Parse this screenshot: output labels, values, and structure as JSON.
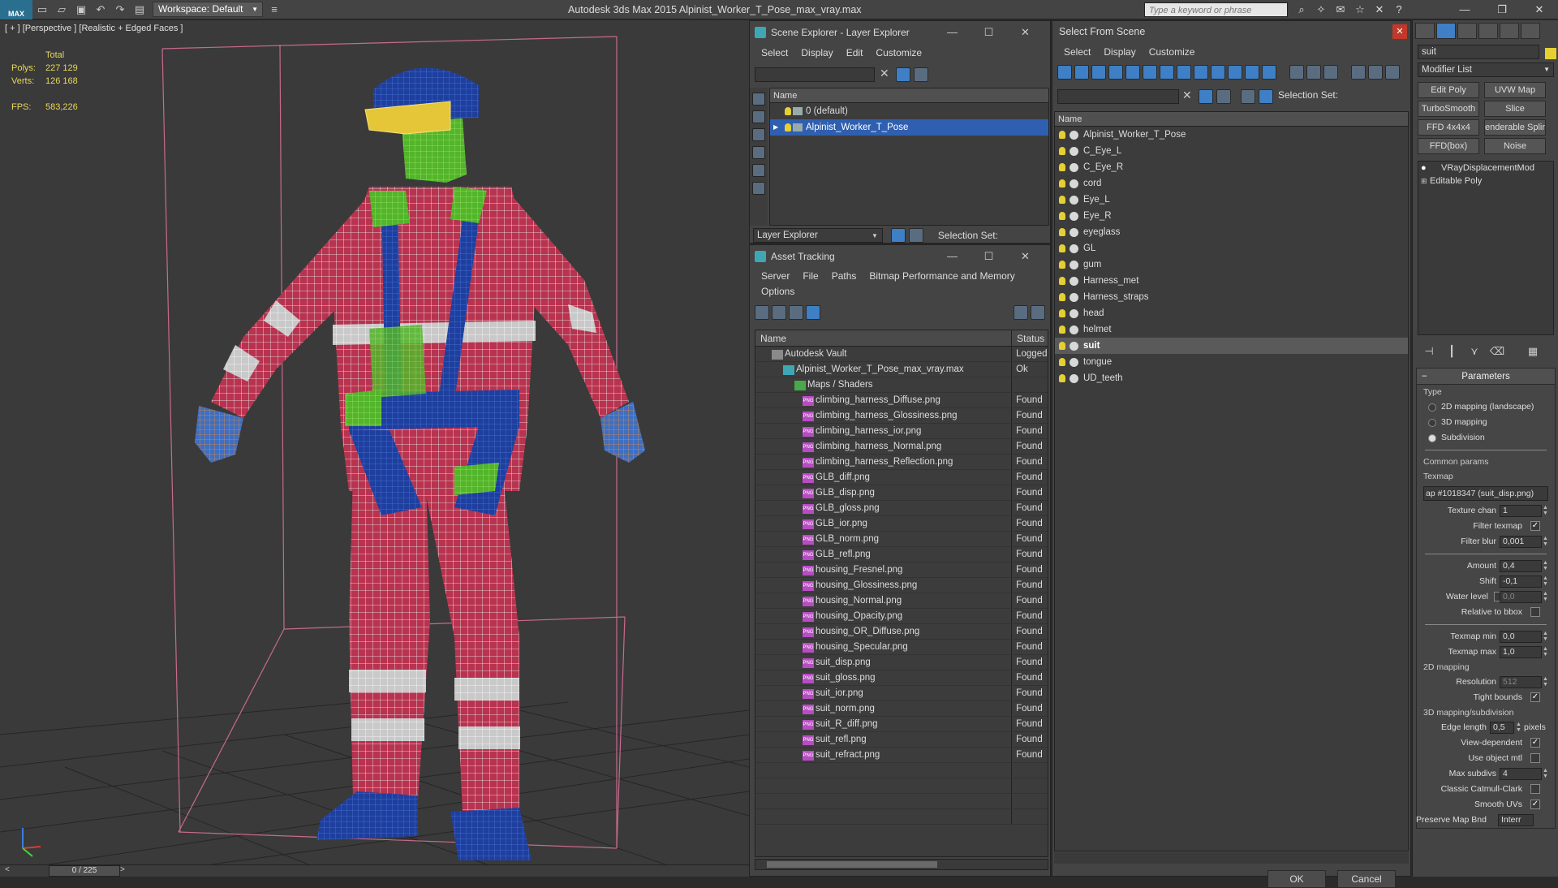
{
  "titlebar": {
    "logo": "MAX",
    "workspace": "Workspace: Default",
    "app_title": "Autodesk 3ds Max  2015     Alpinist_Worker_T_Pose_max_vray.max",
    "search_placeholder": "Type a keyword or phrase"
  },
  "viewport": {
    "label": "[ + ] [Perspective ] [Realistic + Edged Faces ]",
    "stats": {
      "total_label": "Total",
      "polys_label": "Polys:",
      "polys": "227 129",
      "verts_label": "Verts:",
      "verts": "126 168",
      "fps_label": "FPS:",
      "fps": "583,226"
    }
  },
  "timeline": {
    "frame": "0 / 225",
    "left": "<",
    "right": ">"
  },
  "scene_explorer": {
    "title": "Scene Explorer - Layer Explorer",
    "menu": [
      "Select",
      "Display",
      "Edit",
      "Customize"
    ],
    "col_name": "Name",
    "layers": [
      {
        "name": "0 (default)",
        "selected": false
      },
      {
        "name": "Alpinist_Worker_T_Pose",
        "selected": true
      }
    ],
    "bottom_dropdown": "Layer Explorer",
    "selection_set_label": "Selection Set:"
  },
  "asset_tracking": {
    "title": "Asset Tracking",
    "menu": [
      "Server",
      "File",
      "Paths",
      "Bitmap Performance and Memory"
    ],
    "menu2": [
      "Options"
    ],
    "col_name": "Name",
    "col_status": "Status",
    "rows": [
      {
        "name": "Autodesk Vault",
        "status": "Logged",
        "indent": 0,
        "icon": "vault"
      },
      {
        "name": "Alpinist_Worker_T_Pose_max_vray.max",
        "status": "Ok",
        "indent": 1,
        "icon": "max"
      },
      {
        "name": "Maps / Shaders",
        "status": "",
        "indent": 2,
        "icon": "maps"
      },
      {
        "name": "climbing_harness_Diffuse.png",
        "status": "Found",
        "indent": 3,
        "icon": "png"
      },
      {
        "name": "climbing_harness_Glossiness.png",
        "status": "Found",
        "indent": 3,
        "icon": "png"
      },
      {
        "name": "climbing_harness_ior.png",
        "status": "Found",
        "indent": 3,
        "icon": "png"
      },
      {
        "name": "climbing_harness_Normal.png",
        "status": "Found",
        "indent": 3,
        "icon": "png"
      },
      {
        "name": "climbing_harness_Reflection.png",
        "status": "Found",
        "indent": 3,
        "icon": "png"
      },
      {
        "name": "GLB_diff.png",
        "status": "Found",
        "indent": 3,
        "icon": "png"
      },
      {
        "name": "GLB_disp.png",
        "status": "Found",
        "indent": 3,
        "icon": "png"
      },
      {
        "name": "GLB_gloss.png",
        "status": "Found",
        "indent": 3,
        "icon": "png"
      },
      {
        "name": "GLB_ior.png",
        "status": "Found",
        "indent": 3,
        "icon": "png"
      },
      {
        "name": "GLB_norm.png",
        "status": "Found",
        "indent": 3,
        "icon": "png"
      },
      {
        "name": "GLB_refl.png",
        "status": "Found",
        "indent": 3,
        "icon": "png"
      },
      {
        "name": "housing_Fresnel.png",
        "status": "Found",
        "indent": 3,
        "icon": "png"
      },
      {
        "name": "housing_Glossiness.png",
        "status": "Found",
        "indent": 3,
        "icon": "png"
      },
      {
        "name": "housing_Normal.png",
        "status": "Found",
        "indent": 3,
        "icon": "png"
      },
      {
        "name": "housing_Opacity.png",
        "status": "Found",
        "indent": 3,
        "icon": "png"
      },
      {
        "name": "housing_OR_Diffuse.png",
        "status": "Found",
        "indent": 3,
        "icon": "png"
      },
      {
        "name": "housing_Specular.png",
        "status": "Found",
        "indent": 3,
        "icon": "png"
      },
      {
        "name": "suit_disp.png",
        "status": "Found",
        "indent": 3,
        "icon": "png"
      },
      {
        "name": "suit_gloss.png",
        "status": "Found",
        "indent": 3,
        "icon": "png"
      },
      {
        "name": "suit_ior.png",
        "status": "Found",
        "indent": 3,
        "icon": "png"
      },
      {
        "name": "suit_norm.png",
        "status": "Found",
        "indent": 3,
        "icon": "png"
      },
      {
        "name": "suit_R_diff.png",
        "status": "Found",
        "indent": 3,
        "icon": "png"
      },
      {
        "name": "suit_refl.png",
        "status": "Found",
        "indent": 3,
        "icon": "png"
      },
      {
        "name": "suit_refract.png",
        "status": "Found",
        "indent": 3,
        "icon": "png"
      }
    ]
  },
  "select_from_scene": {
    "title": "Select From Scene",
    "menu": [
      "Select",
      "Display",
      "Customize"
    ],
    "selection_set_label": "Selection Set:",
    "col_name": "Name",
    "objects": [
      {
        "name": "Alpinist_Worker_T_Pose",
        "selected": false
      },
      {
        "name": "C_Eye_L",
        "selected": false
      },
      {
        "name": "C_Eye_R",
        "selected": false
      },
      {
        "name": "cord",
        "selected": false
      },
      {
        "name": "Eye_L",
        "selected": false
      },
      {
        "name": "Eye_R",
        "selected": false
      },
      {
        "name": "eyeglass",
        "selected": false
      },
      {
        "name": "GL",
        "selected": false
      },
      {
        "name": "gum",
        "selected": false
      },
      {
        "name": "Harness_met",
        "selected": false
      },
      {
        "name": "Harness_straps",
        "selected": false
      },
      {
        "name": "head",
        "selected": false
      },
      {
        "name": "helmet",
        "selected": false
      },
      {
        "name": "suit",
        "selected": true
      },
      {
        "name": "tongue",
        "selected": false
      },
      {
        "name": "UD_teeth",
        "selected": false
      }
    ],
    "ok": "OK",
    "cancel": "Cancel"
  },
  "command_panel": {
    "object_name": "suit",
    "modifier_list": "Modifier List",
    "mod_buttons": [
      "Edit Poly",
      "UVW Map",
      "TurboSmooth",
      "Slice",
      "FFD 4x4x4",
      "enderable Splin",
      "FFD(box)",
      "Noise"
    ],
    "stack": [
      "VRayDisplacementMod",
      "Editable Poly"
    ],
    "params": {
      "rollout": "Parameters",
      "type_label": "Type",
      "types": [
        "2D mapping (landscape)",
        "3D mapping",
        "Subdivision"
      ],
      "selected_type": 2,
      "common_label": "Common params",
      "texmap_label": "Texmap",
      "texmap_value": "ap #1018347 (suit_disp.png)",
      "texture_chan_label": "Texture chan",
      "texture_chan": "1",
      "filter_texmap_label": "Filter texmap",
      "filter_blur_label": "Filter blur",
      "filter_blur": "0,001",
      "amount_label": "Amount",
      "amount": "0,4",
      "shift_label": "Shift",
      "shift": "-0,1",
      "water_level_label": "Water level",
      "water_level": "0,0",
      "relative_label": "Relative to bbox",
      "texmap_min_label": "Texmap min",
      "texmap_min": "0,0",
      "texmap_max_label": "Texmap max",
      "texmap_max": "1,0",
      "map2d_label": "2D mapping",
      "resolution_label": "Resolution",
      "resolution": "512",
      "tight_label": "Tight bounds",
      "map3d_label": "3D mapping/subdivision",
      "edge_length_label": "Edge length",
      "edge_length": "0,5",
      "pixels_label": "pixels",
      "view_dep_label": "View-dependent",
      "use_obj_label": "Use object mtl",
      "max_subdivs_label": "Max subdivs",
      "max_subdivs": "4",
      "catmull_label": "Classic Catmull-Clark",
      "smooth_uvs_label": "Smooth UVs",
      "preserve_label": "Preserve Map Bnd",
      "preserve_value": "Interr"
    }
  },
  "colors": {
    "suit": "#b8334f",
    "stripe": "#c9c9c9",
    "harness": "#1e3f9e",
    "harness_green": "#52b52a",
    "grid": "#1f1f1f",
    "box": "#c76a8e"
  }
}
